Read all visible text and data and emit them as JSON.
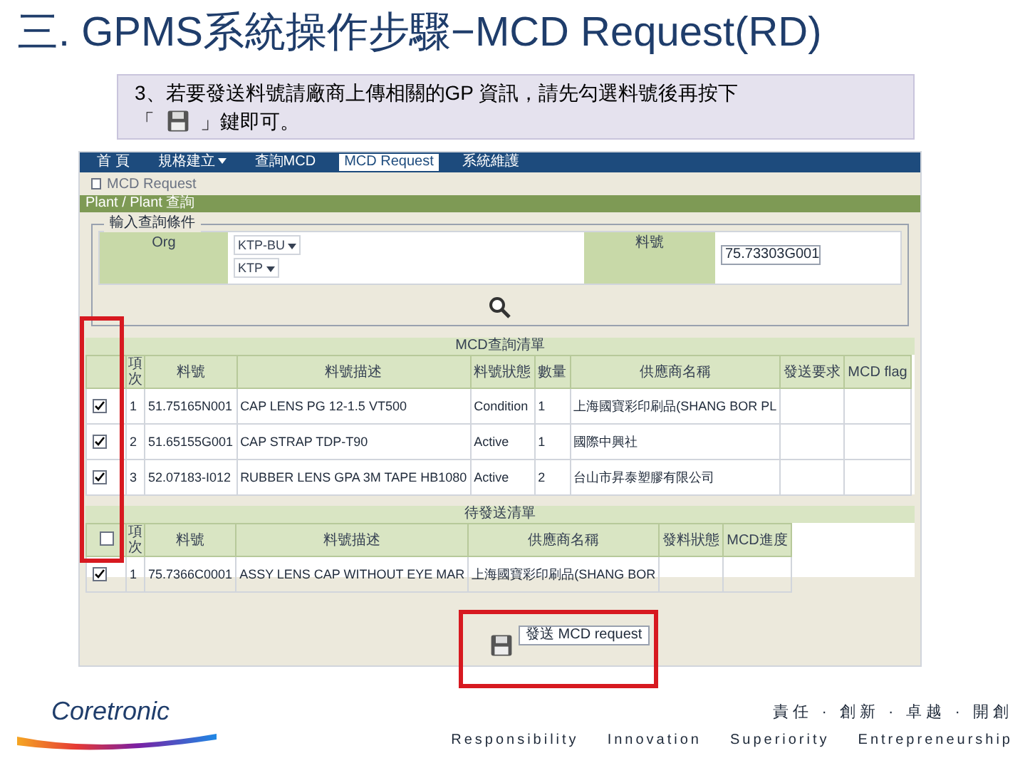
{
  "slide": {
    "title": "三. GPMS系統操作步驟−MCD Request(RD)",
    "instruction_line1": "3、若要發送料號請廠商上傳相關的GP 資訊，請先勾選料號後再按下",
    "instruction_open": "「",
    "instruction_close": "」鍵即可。"
  },
  "app": {
    "nav": [
      {
        "label": "首 頁",
        "selected": false,
        "dropdown": false
      },
      {
        "label": "規格建立",
        "selected": false,
        "dropdown": true
      },
      {
        "label": "查詢MCD",
        "selected": false,
        "dropdown": false
      },
      {
        "label": "MCD Request",
        "selected": true,
        "dropdown": false
      },
      {
        "label": "系統維護",
        "selected": false,
        "dropdown": false
      }
    ],
    "breadcrumb": "MCD Request",
    "section_bar": "Plant / Plant 查詢",
    "query": {
      "legend": "輸入查詢條件",
      "org_label": "Org",
      "org_values": [
        "KTP-BU",
        "KTP"
      ],
      "part_label": "料號",
      "part_value": "75.73303G001"
    },
    "result_table": {
      "title": "MCD查詢清單",
      "columns": [
        "項次",
        "料號",
        "料號描述",
        "料號狀態",
        "數量",
        "供應商名稱",
        "發送要求",
        "MCD flag"
      ],
      "rows": [
        {
          "checked": true,
          "cells": [
            "1",
            "51.75165N001",
            "CAP LENS PG 12-1.5 VT500",
            "Condition",
            "1",
            "上海國寶彩印刷品(SHANG BOR PL",
            "",
            ""
          ]
        },
        {
          "checked": true,
          "cells": [
            "2",
            "51.65155G001",
            "CAP STRAP TDP-T90",
            "Active",
            "1",
            "國際中興社",
            "",
            ""
          ]
        },
        {
          "checked": true,
          "cells": [
            "3",
            "52.07183-I012",
            "RUBBER LENS GPA 3M TAPE HB1080",
            "Active",
            "2",
            "台山市昇泰塑膠有限公司",
            "",
            ""
          ]
        }
      ]
    },
    "send_table": {
      "title": "待發送清單",
      "header_checked": false,
      "columns": [
        "項次",
        "料號",
        "料號描述",
        "供應商名稱",
        "發料狀態",
        "MCD進度"
      ],
      "rows": [
        {
          "checked": true,
          "cells": [
            "1",
            "75.7366C0001",
            "ASSY LENS CAP WITHOUT EYE MAR",
            "上海國寶彩印刷品(SHANG BOR",
            "",
            ""
          ]
        }
      ]
    },
    "send_tooltip": "發送 MCD request"
  },
  "footer": {
    "logo": "Coretronic",
    "values_zh": "責任 · 創新 · 卓越 · 開創",
    "values_en": [
      "Responsibility",
      "Innovation",
      "Superiority",
      "Entrepreneurship"
    ]
  }
}
